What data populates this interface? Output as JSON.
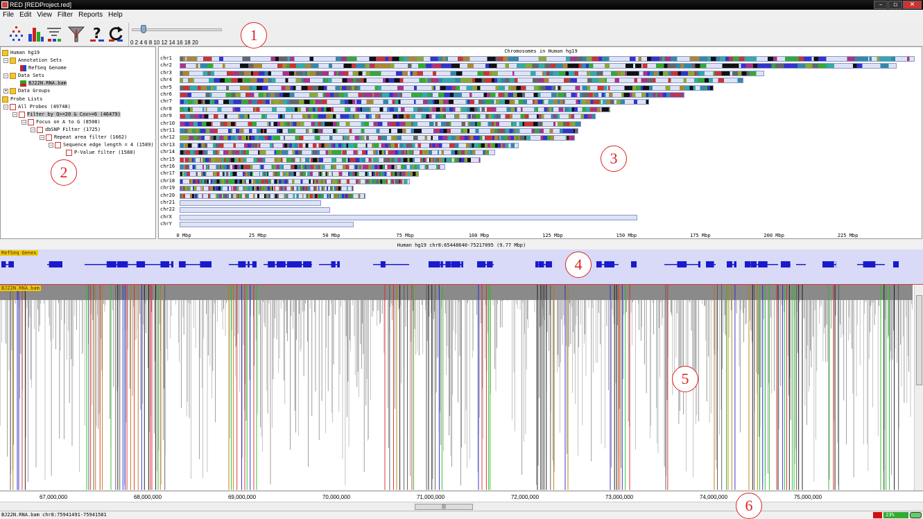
{
  "window": {
    "title": "RED [REDProject.red]"
  },
  "menu": [
    "File",
    "Edit",
    "View",
    "Filter",
    "Reports",
    "Help"
  ],
  "toolbar": {
    "icons": [
      "probe-generator-icon",
      "histogram-icon",
      "tree-icon",
      "filter-icon",
      "help-icon",
      "refresh-icon"
    ],
    "slider_ticks": "0 2 4 6 8 10 12 14 16 18 20",
    "slider_value": 2
  },
  "callouts": [
    "1",
    "2",
    "3",
    "4",
    "5",
    "6"
  ],
  "tree": {
    "root": "Human hg19",
    "annotation_sets": "Annotation Sets",
    "refseq": "RefSeq Genome",
    "data_sets": "Data Sets",
    "dataset": "BJ22N.RNA.bam",
    "data_groups": "Data Groups",
    "probe_lists": "Probe Lists",
    "all_probes": "All Probes (49748)",
    "filter1": "Filter by Q>=20 & Cov>=6 (46479)",
    "filter2": "Focus on A to G (8508)",
    "filter3": "dbSNP Filter (1725)",
    "filter4": "Repeat area filter (1662)",
    "filter5": "Sequence edge length = 4 (1589)",
    "filter6": "P-Value filter (1588)"
  },
  "chromosome_view": {
    "title": "Chromosomes in  Human hg19",
    "chromosomes": [
      "chr1",
      "chr2",
      "chr3",
      "chr4",
      "chr5",
      "chr6",
      "chr7",
      "chr8",
      "chr9",
      "chr10",
      "chr11",
      "chr12",
      "chr13",
      "chr14",
      "chr15",
      "chr16",
      "chr17",
      "chr18",
      "chr19",
      "chr20",
      "chr21",
      "chr22",
      "chrX",
      "chrY"
    ],
    "lengths_mbp": [
      249,
      243,
      198,
      191,
      181,
      171,
      159,
      146,
      141,
      136,
      135,
      134,
      115,
      107,
      102,
      90,
      81,
      78,
      59,
      63,
      48,
      51,
      155,
      59
    ],
    "axis_ticks": [
      "0 Mbp",
      "25 Mbp",
      "50 Mbp",
      "75 Mbp",
      "100 Mbp",
      "125 Mbp",
      "150 Mbp",
      "175 Mbp",
      "200 Mbp",
      "225 Mbp"
    ]
  },
  "region": {
    "text": "Human hg19  chr8:65448640-75217095 (9.77 Mbp)"
  },
  "gene_track": {
    "label": "RefSeq Genes"
  },
  "data_track": {
    "label": "BJ22N.RNA.bam"
  },
  "position_axis": [
    "67,000,000",
    "68,000,000",
    "69,000,000",
    "70,000,000",
    "71,000,000",
    "72,000,000",
    "73,000,000",
    "74,000,000",
    "75,000,000"
  ],
  "status": {
    "text": "BJ22N.RNA.bam chr8:75941491-75941581",
    "memory": "23%"
  }
}
